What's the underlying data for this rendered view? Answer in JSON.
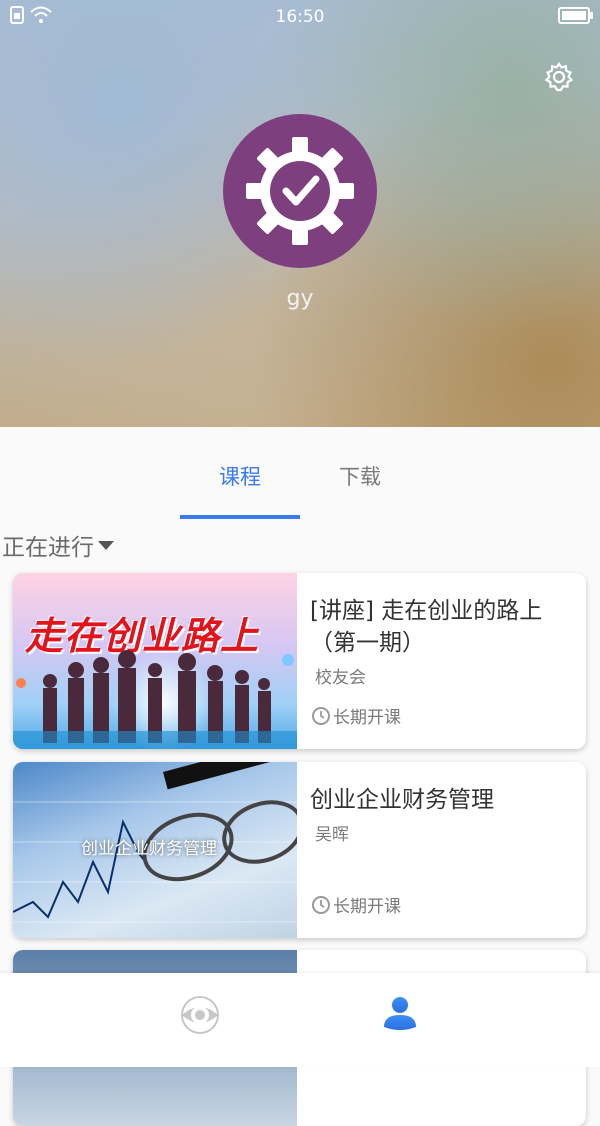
{
  "status_bar": {
    "time": "16:50"
  },
  "profile": {
    "username": "gy"
  },
  "tabs": [
    {
      "label": "课程",
      "active": true
    },
    {
      "label": "下载",
      "active": false
    }
  ],
  "filter": {
    "label": "正在进行"
  },
  "courses": [
    {
      "title": "[讲座] 走在创业的路上（第一期）",
      "author": "校友会",
      "period": "长期开课",
      "thumb_text": "走在创业路上"
    },
    {
      "title": "创业企业财务管理",
      "author": "吴晖",
      "period": "长期开课",
      "thumb_text": "创业企业财务管理"
    }
  ],
  "icons": {
    "settings": "gear-icon",
    "clock": "clock-icon",
    "discover": "eye-icon",
    "profile": "user-icon"
  },
  "colors": {
    "accent": "#3b7bf0",
    "avatar_bg": "#7d3f7d"
  }
}
